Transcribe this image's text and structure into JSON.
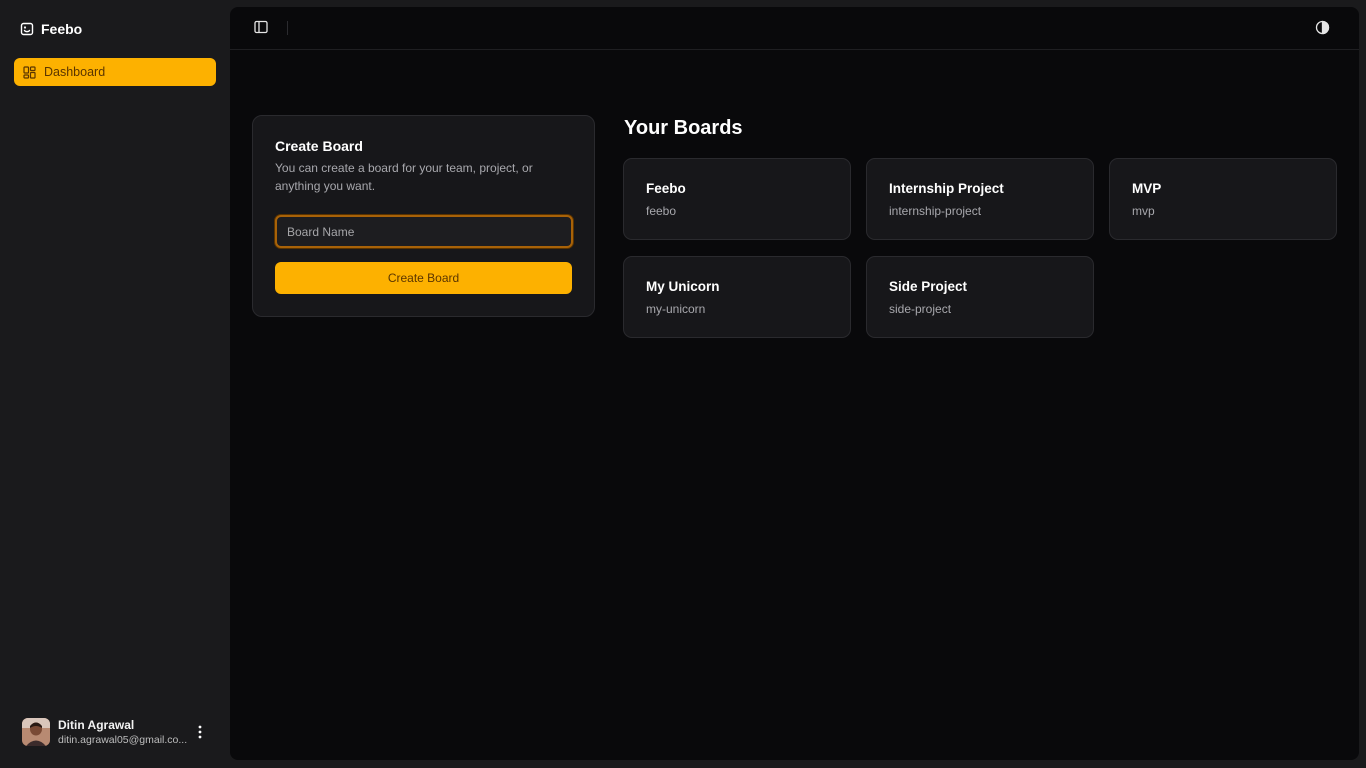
{
  "app": {
    "name": "Feebo"
  },
  "sidebar": {
    "nav": [
      {
        "label": "Dashboard",
        "icon": "dashboard-grid-icon",
        "active": true
      }
    ]
  },
  "user": {
    "name": "Ditin Agrawal",
    "email": "ditin.agrawal05@gmail.co..."
  },
  "create_board": {
    "title": "Create Board",
    "description": "You can create a board for your team, project, or anything you want.",
    "input_placeholder": "Board Name",
    "input_value": "",
    "button_label": "Create Board"
  },
  "boards": {
    "heading": "Your Boards",
    "items": [
      {
        "name": "Feebo",
        "slug": "feebo"
      },
      {
        "name": "Internship Project",
        "slug": "internship-project"
      },
      {
        "name": "MVP",
        "slug": "mvp"
      },
      {
        "name": "My Unicorn",
        "slug": "my-unicorn"
      },
      {
        "name": "Side Project",
        "slug": "side-project"
      }
    ]
  },
  "colors": {
    "accent": "#fdb100",
    "accent_text": "#5a3500",
    "sidebar_bg": "#1a1a1c",
    "main_bg": "#09090b",
    "card_bg": "#17171a"
  }
}
